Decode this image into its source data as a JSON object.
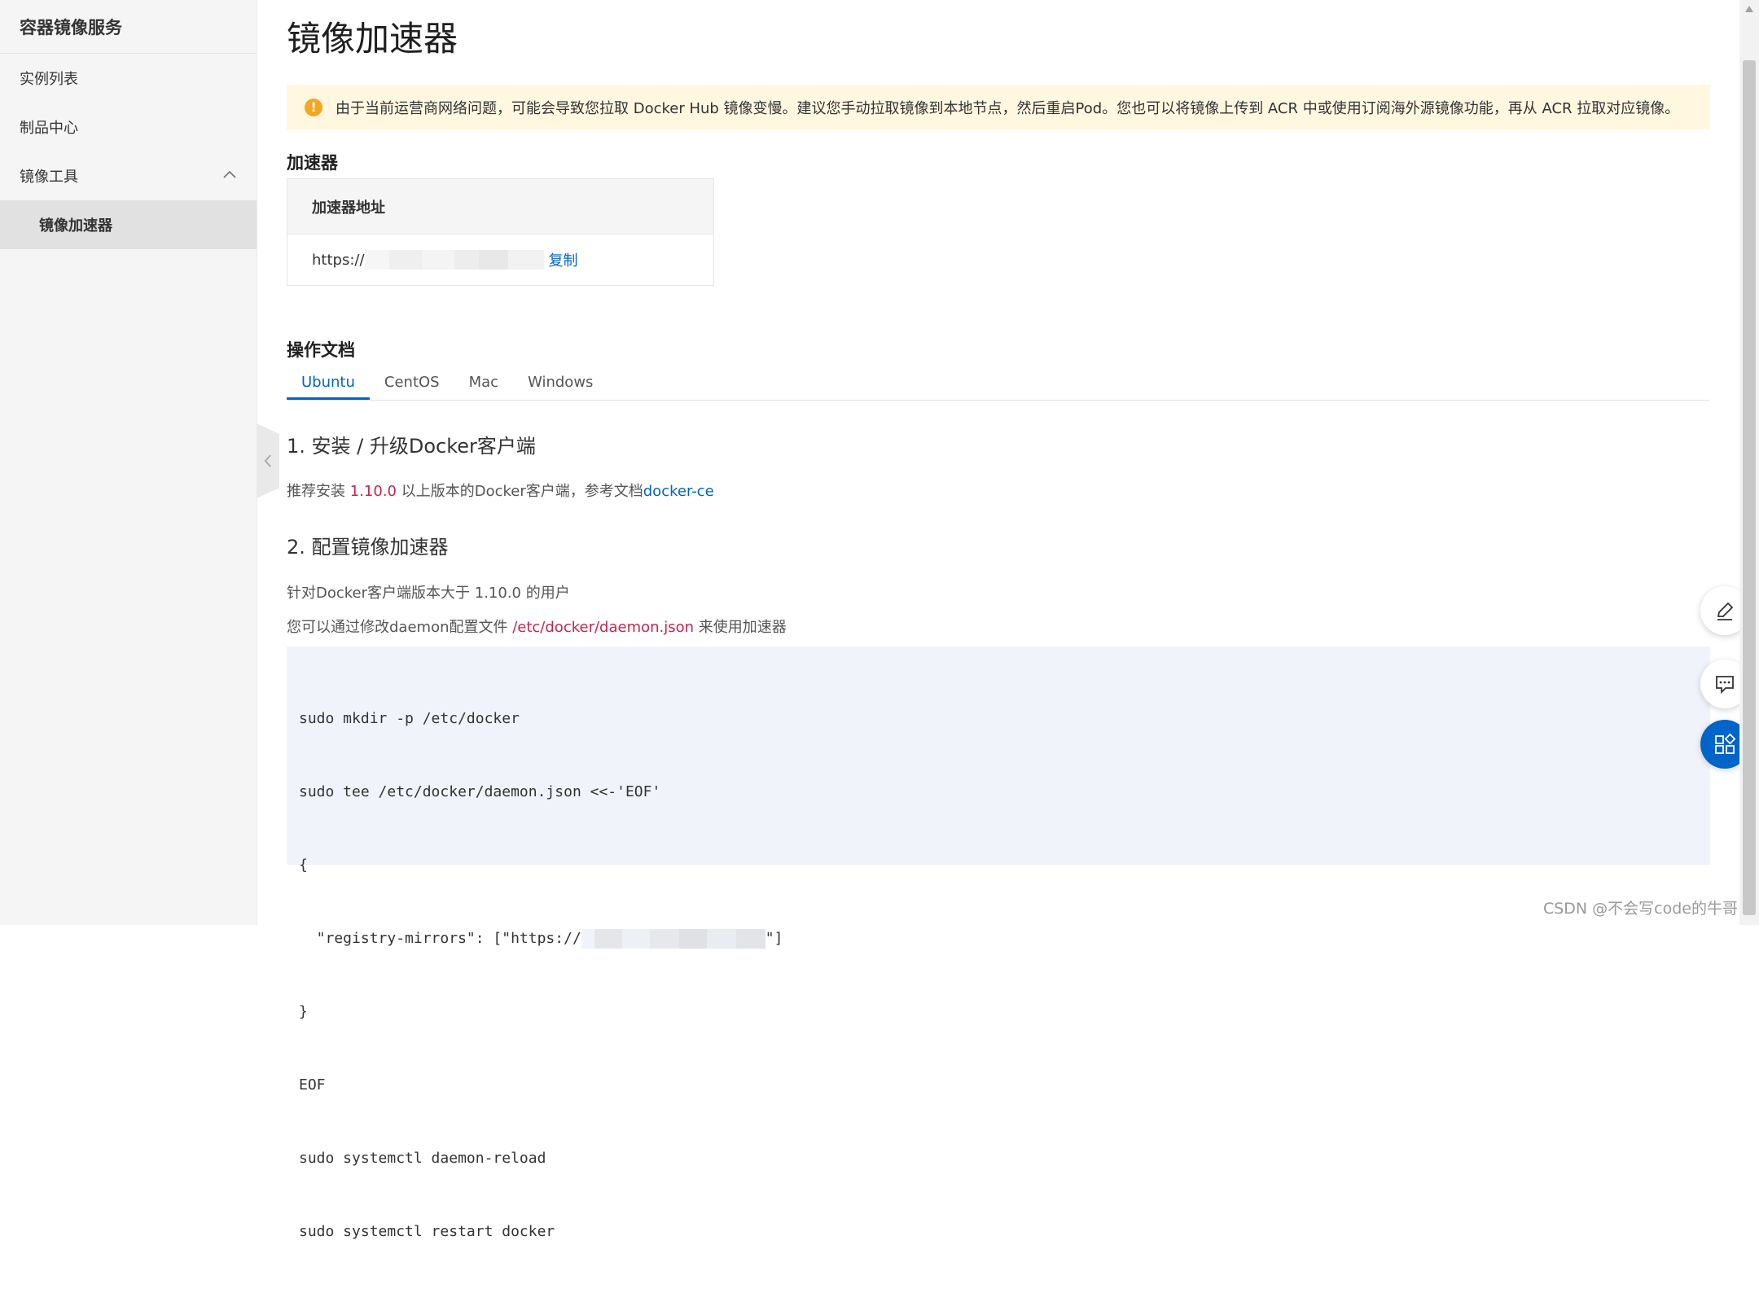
{
  "sidebar": {
    "title": "容器镜像服务",
    "items": [
      {
        "label": "实例列表"
      },
      {
        "label": "制品中心"
      },
      {
        "label": "镜像工具"
      },
      {
        "label": "镜像加速器"
      }
    ]
  },
  "main": {
    "title": "镜像加速器",
    "alert": "由于当前运营商网络问题，可能会导致您拉取 Docker Hub 镜像变慢。建议您手动拉取镜像到本地节点，然后重启Pod。您也可以将镜像上传到 ACR 中或使用订阅海外源镜像功能，再从 ACR 拉取对应镜像。",
    "accelerator": {
      "section_title": "加速器",
      "column_header": "加速器地址",
      "url_prefix": "https://",
      "copy_label": "复制"
    },
    "docs": {
      "section_title": "操作文档",
      "tabs": [
        {
          "label": "Ubuntu",
          "active": true
        },
        {
          "label": "CentOS"
        },
        {
          "label": "Mac"
        },
        {
          "label": "Windows"
        }
      ],
      "step1": {
        "title": "1. 安装 / 升级Docker客户端",
        "text_a": "推荐安装 ",
        "version": "1.10.0",
        "text_b": " 以上版本的Docker客户端，参考文档",
        "link": "docker-ce"
      },
      "step2": {
        "title": "2. 配置镜像加速器",
        "line1": "针对Docker客户端版本大于 1.10.0 的用户",
        "line2_a": "您可以通过修改daemon配置文件 ",
        "line2_path": "/etc/docker/daemon.json",
        "line2_b": " 来使用加速器"
      },
      "code": [
        "sudo mkdir -p /etc/docker",
        "sudo tee /etc/docker/daemon.json <<-'EOF'",
        "{",
        "  \"registry-mirrors\": [\"https://",
        "}",
        "EOF",
        "sudo systemctl daemon-reload",
        "sudo systemctl restart docker"
      ],
      "code_mirror_end": "\"]"
    }
  },
  "watermark": "CSDN @不会写code的牛哥",
  "icons": {
    "edit": "edit-icon",
    "feedback": "chat-icon",
    "apps": "apps-icon"
  },
  "colors": {
    "accent": "#0064c8",
    "alert_bg": "#fff7e0",
    "warning": "#f5a623",
    "highlight_red": "#c7254e"
  }
}
